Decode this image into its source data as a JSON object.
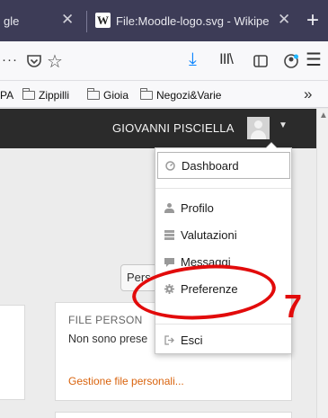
{
  "browser": {
    "tabs": [
      {
        "label": "gle",
        "close": "✕"
      },
      {
        "label": "File:Moodle-logo.svg - Wikipe",
        "close": "✕",
        "favicon": "W"
      }
    ],
    "new_tab": "+",
    "toolbar": {
      "ellipsis": "···",
      "star": "☆",
      "download": "⤓",
      "library": "III\\",
      "menu": "☰"
    },
    "bookmarks": [
      {
        "label": "PA"
      },
      {
        "label": "Zippilli"
      },
      {
        "label": "Gioia"
      },
      {
        "label": "Negozi&Varie"
      }
    ],
    "bookmarks_overflow": "»"
  },
  "moodle": {
    "user_name": "GIOVANNI PISCIELLA",
    "user_menu_caret": "▼",
    "user_menu": {
      "dashboard": "Dashboard",
      "profile": "Profilo",
      "grades": "Valutazioni",
      "messages": "Messaggi",
      "preferences": "Preferenze",
      "logout": "Esci"
    },
    "customize_button": "Pers",
    "files_block": {
      "title": "FILE PERSON",
      "body": "Non sono prese",
      "link": "Gestione file personali..."
    }
  },
  "annotation": {
    "step_number": "7",
    "color": "#e20b0b"
  },
  "colors": {
    "tabstrip": "#3d3c57",
    "navbar": "#2b2b2b",
    "link_orange": "#d9630d",
    "download_blue": "#0a84ff"
  }
}
